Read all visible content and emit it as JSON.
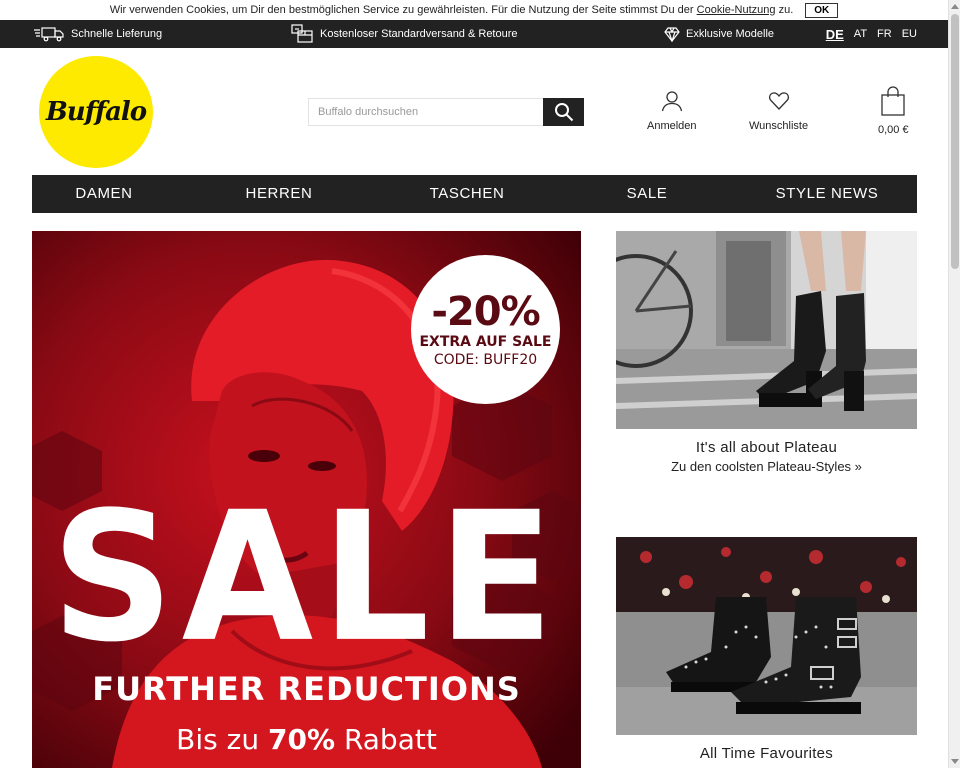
{
  "cookie_bar": {
    "text": "Wir verwenden Cookies, um Dir den bestmöglichen Service zu gewährleisten. Für die Nutzung der Seite stimmst Du der",
    "link": "Cookie-Nutzung",
    "suffix": "zu.",
    "ok_label": "OK"
  },
  "usp_bar": {
    "items": [
      {
        "icon": "truck-icon",
        "label": "Schnelle Lieferung"
      },
      {
        "icon": "box-return-icon",
        "label": "Kostenloser Standardversand & Retoure"
      },
      {
        "icon": "diamond-icon",
        "label": "Exklusive Modelle"
      }
    ],
    "languages": [
      "DE",
      "AT",
      "FR",
      "EU"
    ],
    "active_language": "DE"
  },
  "header": {
    "logo_text": "Buffalo",
    "search": {
      "placeholder": "Buffalo durchsuchen",
      "value": ""
    },
    "login_label": "Anmelden",
    "wishlist_label": "Wunschliste",
    "cart_total": "0,00 €"
  },
  "nav": {
    "items": [
      "DAMEN",
      "HERREN",
      "TASCHEN",
      "SALE",
      "STYLE NEWS"
    ]
  },
  "hero": {
    "badge_percent": "-20%",
    "badge_extra": "EXTRA AUF SALE",
    "badge_code": "CODE: BUFF20",
    "headline": "SALE",
    "subline": "FURTHER REDUCTIONS",
    "discount_prefix": "Bis zu",
    "discount_value": "70%",
    "discount_suffix": "Rabatt"
  },
  "teasers": [
    {
      "title": "It's all about Plateau",
      "link": "Zu den coolsten Plateau-Styles »"
    },
    {
      "title": "All Time Favourites",
      "link": ""
    }
  ],
  "colors": {
    "dark_bar": "#222222",
    "logo_yellow": "#fdea00",
    "hero_red": "#8a0a14",
    "badge_text": "#5a0a12"
  }
}
